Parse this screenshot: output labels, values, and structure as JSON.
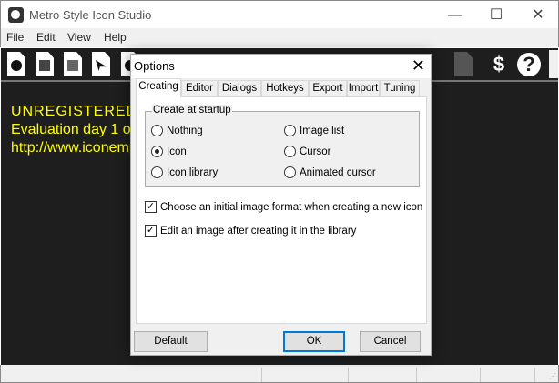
{
  "window": {
    "title": "Metro Style Icon Studio",
    "minimize": "—",
    "maximize": "☐",
    "close": "✕"
  },
  "menu": [
    "File",
    "Edit",
    "View",
    "Help"
  ],
  "toolbar": {
    "icons": [
      "new-icon",
      "new-image-list",
      "new-icon-library",
      "new-cursor",
      "new-animated-cursor"
    ],
    "buy_icon": "$",
    "help_icon": "?"
  },
  "workspace": {
    "lines": [
      "UNREGISTERED",
      "Evaluation day 1 of",
      "http://www.iconemp"
    ],
    "text_color": "#ffff00"
  },
  "dialog": {
    "title": "Options",
    "close": "✕",
    "tabs": [
      "Creating",
      "Editor",
      "Dialogs",
      "Hotkeys",
      "Export",
      "Import",
      "Tuning"
    ],
    "active_tab": "Creating",
    "group_label": "Create at startup",
    "radios": [
      {
        "label": "Nothing",
        "checked": false
      },
      {
        "label": "Icon",
        "checked": true
      },
      {
        "label": "Icon library",
        "checked": false
      },
      {
        "label": "Image list",
        "checked": false
      },
      {
        "label": "Cursor",
        "checked": false
      },
      {
        "label": "Animated cursor",
        "checked": false
      }
    ],
    "checks": [
      {
        "label": "Choose an initial image format when creating a new icon",
        "checked": true
      },
      {
        "label": "Edit an image after creating it in the library",
        "checked": true
      }
    ],
    "buttons": {
      "default": "Default",
      "ok": "OK",
      "cancel": "Cancel"
    }
  }
}
